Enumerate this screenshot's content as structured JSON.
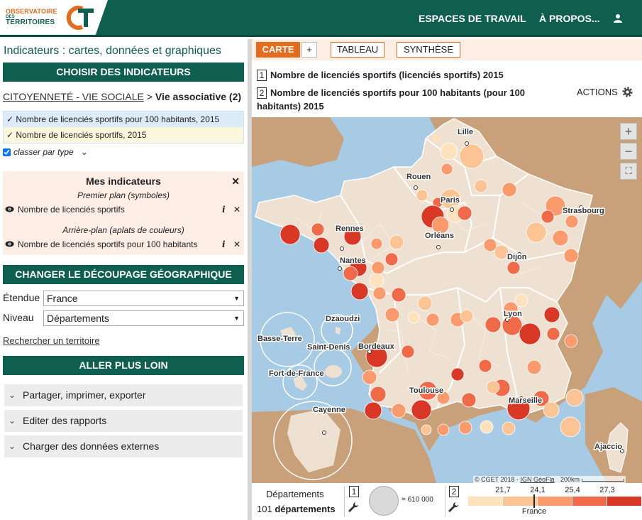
{
  "logo": {
    "line1": "OBSERVATOIRE",
    "line2": "DES",
    "line3": "TERRITOIRES"
  },
  "nav": {
    "workspaces": "ESPACES DE TRAVAIL",
    "about": "À PROPOS..."
  },
  "left": {
    "title": "Indicateurs : cartes, données et graphiques",
    "choose_bar": "CHOISIR DES INDICATEURS",
    "crumb_link": "CITOYENNETÉ - VIE SOCIALE",
    "crumb_sep": ">",
    "crumb_current": "Vie associative (2)",
    "selected": [
      "✓ Nombre de licenciés sportifs pour 100 habitants, 2015",
      "✓ Nombre de licenciés sportifs, 2015"
    ],
    "classer_label": "classer par type",
    "mine": {
      "title": "Mes indicateurs",
      "fg_title": "Premier plan (symboles)",
      "fg_item": "Nombre de licenciés sportifs",
      "bg_title": "Arrière-plan (aplats de couleurs)",
      "bg_item": "Nombre de licenciés sportifs pour 100 habitants"
    },
    "geo_bar": "CHANGER LE DÉCOUPAGE GÉOGRAPHIQUE",
    "extent_label": "Étendue",
    "extent_value": "France",
    "level_label": "Niveau",
    "level_value": "Départements",
    "search_link": "Rechercher un territoire",
    "further_bar": "ALLER PLUS LOIN",
    "accordions": [
      "Partager, imprimer, exporter",
      "Editer des rapports",
      "Charger des données externes"
    ]
  },
  "right": {
    "tabs": {
      "map": "CARTE",
      "plus": "+",
      "table": "TABLEAU",
      "synthesis": "SYNTHÈSE"
    },
    "ind1_num": "1",
    "ind1": "Nombre de licenciés sportifs (licenciés sportifs) 2015",
    "ind2_num": "2",
    "ind2_a": "Nombre de licenciés sportifs pour 100 habitants (pour 100",
    "ind2_b": "habitants) 2015",
    "actions": "ACTIONS",
    "map_labels": [
      "Lille",
      "Rouen",
      "Paris",
      "Strasbourg",
      "Rennes",
      "Orléans",
      "Dijon",
      "Nantes",
      "Dzaoudzi",
      "Lyon",
      "Basse-Terre",
      "Saint-Denis",
      "Bordeaux",
      "Fort-de-France",
      "Toulouse",
      "Marseille",
      "Cayenne",
      "Ajaccio"
    ],
    "attribution": {
      "credit": "© CGET 2018 - ",
      "source": "IGN GéoFla",
      "scale": "200km"
    }
  },
  "legend": {
    "level_label": "Départements",
    "count_num": "101",
    "count_label": "départements",
    "box1": "1",
    "circle_value": "= 610 000",
    "box2": "2",
    "thresholds": [
      "21,7",
      "24,1",
      "25,4",
      "27,3"
    ],
    "ref_label": "France",
    "colors": [
      "#fde2bd",
      "#fcc394",
      "#fb9a6d",
      "#f06a49",
      "#d93826"
    ]
  }
}
